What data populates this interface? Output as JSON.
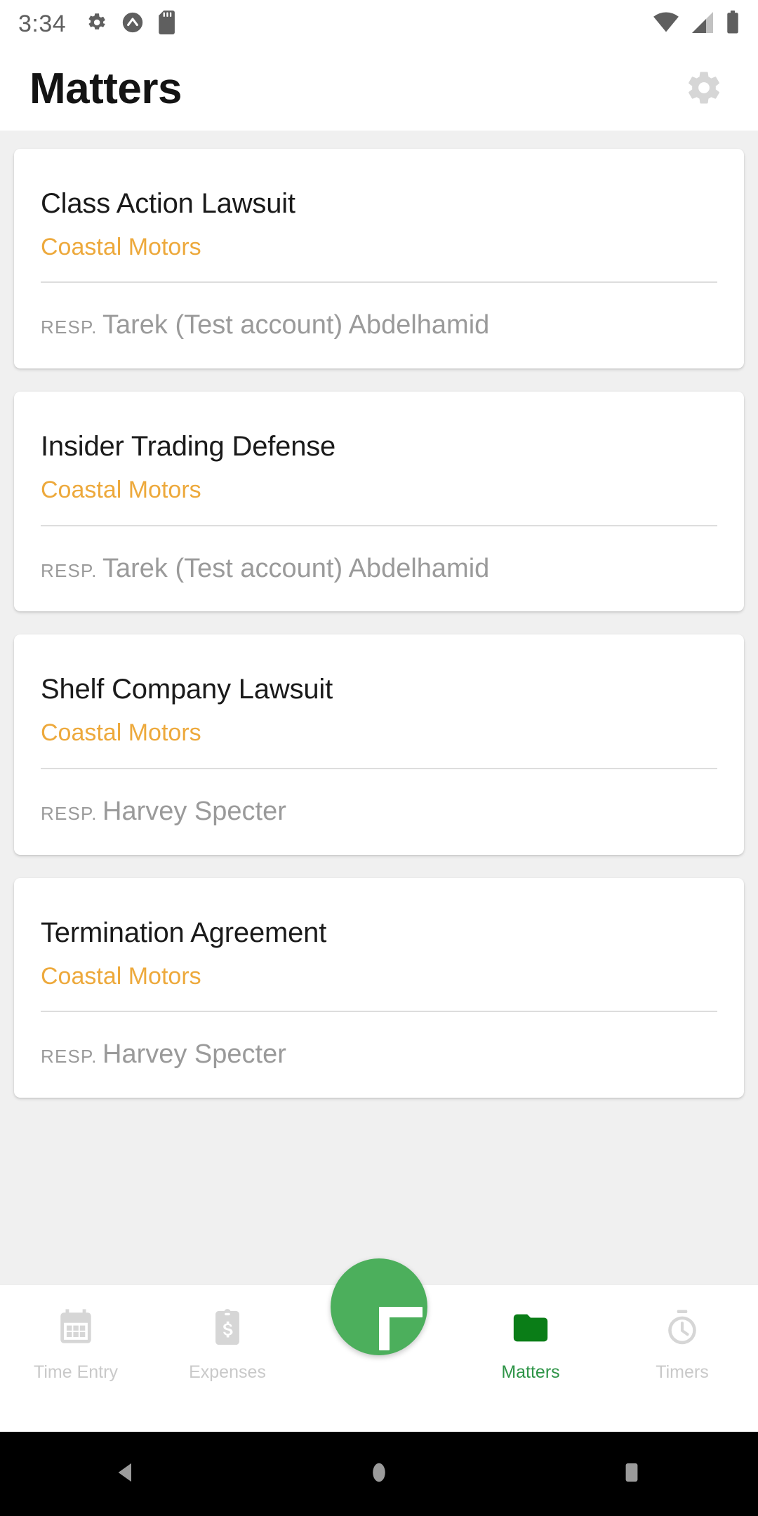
{
  "status_bar": {
    "time": "3:34",
    "left_icons": [
      "gear-icon",
      "circle-chevron-up-icon",
      "sd-card-icon"
    ],
    "right_icons": [
      "wifi-icon",
      "cellular-signal-icon",
      "battery-icon"
    ]
  },
  "header": {
    "title": "Matters",
    "settings_icon": "gear-icon"
  },
  "matters": [
    {
      "title": "Class Action Lawsuit",
      "client": "Coastal Motors",
      "resp_label": "RESP.",
      "resp_value": "Tarek (Test account) Abdelhamid"
    },
    {
      "title": "Insider Trading Defense",
      "client": "Coastal Motors",
      "resp_label": "RESP.",
      "resp_value": "Tarek (Test account) Abdelhamid"
    },
    {
      "title": "Shelf Company Lawsuit",
      "client": "Coastal Motors",
      "resp_label": "RESP.",
      "resp_value": "Harvey Specter"
    },
    {
      "title": "Termination Agreement",
      "client": "Coastal Motors",
      "resp_label": "RESP.",
      "resp_value": "Harvey Specter"
    }
  ],
  "fab": {
    "icon": "plus-icon",
    "color": "#4caf5c"
  },
  "bottom_nav": {
    "items": [
      {
        "label": "Time Entry",
        "icon": "calendar-icon",
        "active": false
      },
      {
        "label": "Expenses",
        "icon": "clipboard-dollar-icon",
        "active": false
      },
      {
        "label": "Matters",
        "icon": "folder-icon",
        "active": true
      },
      {
        "label": "Timers",
        "icon": "stopwatch-icon",
        "active": false
      }
    ],
    "active_color": "#2e9447",
    "inactive_color": "#c9c9c9"
  },
  "system_nav": {
    "buttons": [
      "back-icon",
      "home-icon",
      "recents-icon"
    ]
  },
  "colors": {
    "accent_orange": "#eda93c",
    "accent_green": "#2e9447",
    "page_background": "#f0f0f0"
  }
}
